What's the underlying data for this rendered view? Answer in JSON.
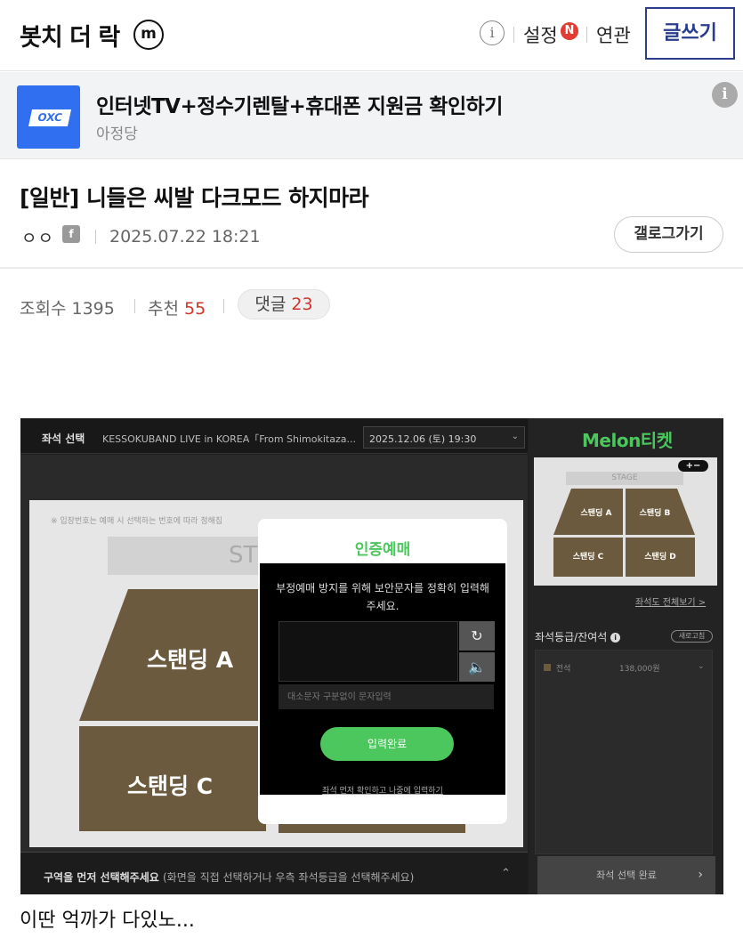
{
  "header": {
    "gallery_name": "봇치 더 락",
    "minor_badge": "m",
    "info_icon": "i",
    "settings_label": "설정",
    "new_badge": "N",
    "related_label": "연관",
    "write_label": "글쓰기"
  },
  "ad": {
    "logo_text": "OXC",
    "title": "인터넷TV+정수기렌탈+휴대폰 지원금 확인하기",
    "advertiser": "아정당",
    "info_icon": "i"
  },
  "post": {
    "title": "[일반] 니들은 씨발 다크모드 하지마라",
    "author": "ㅇㅇ",
    "author_icon": "f",
    "date": "2025.07.22 18:21",
    "gallog_label": "갤로그가기",
    "views_label": "조회수",
    "views": "1395",
    "recommend_label": "추천",
    "recommend": "55",
    "comments_label": "댓글",
    "comments": "23",
    "caption": "이딴 억까가 다있노..."
  },
  "screenshot": {
    "seat_select_title": "좌석 선택",
    "event_name": "KESSOKUBAND LIVE in KOREA「From Shimokitaza...",
    "date_option": "2025.12.06 (토) 19:30",
    "notice": "※ 입장번호는 예매 시 선택하는 번호에 따라 정해집",
    "stage_text": "ST",
    "blocks": {
      "a": "스탠딩 A",
      "c": "스탠딩 C"
    },
    "bottom_bar_main": "구역을 먼저 선택해주세요",
    "bottom_bar_sub": "(화면을 직접 선택하거나 우측 좌석등급을 선택해주세요)",
    "modal": {
      "title": "인증예매",
      "description": "부정예매 방지를 위해 보안문자를 정확히 입력해주세요.",
      "refresh_icon": "↻",
      "audio_icon": "🔈",
      "input_placeholder": "대소문자 구분없이 문자입력",
      "submit_label": "입력완료",
      "later_link": "좌석 먼저 확인하고 나중에 입력하기"
    },
    "right_panel": {
      "brand": "Melon티켓",
      "minimap_stage": "STAGE",
      "minimap_zoom": "+−",
      "minimap_blocks": [
        "스탠딩 A",
        "스탠딩 B",
        "스탠딩 C",
        "스탠딩 D"
      ],
      "view_all": "좌석도 전체보기 >",
      "grade_label": "좌석등급/잔여석",
      "grade_info": "i",
      "refresh_label": "새로고침",
      "grade_name": "전석",
      "grade_price": "138,000원",
      "done_label": "좌석 선택 완료",
      "done_arrow": "›"
    }
  },
  "colors": {
    "accent_navy": "#2a3c8c",
    "melon_green": "#4cc75e",
    "stat_red": "#d0342c",
    "block_brown": "#6b5a3e"
  }
}
